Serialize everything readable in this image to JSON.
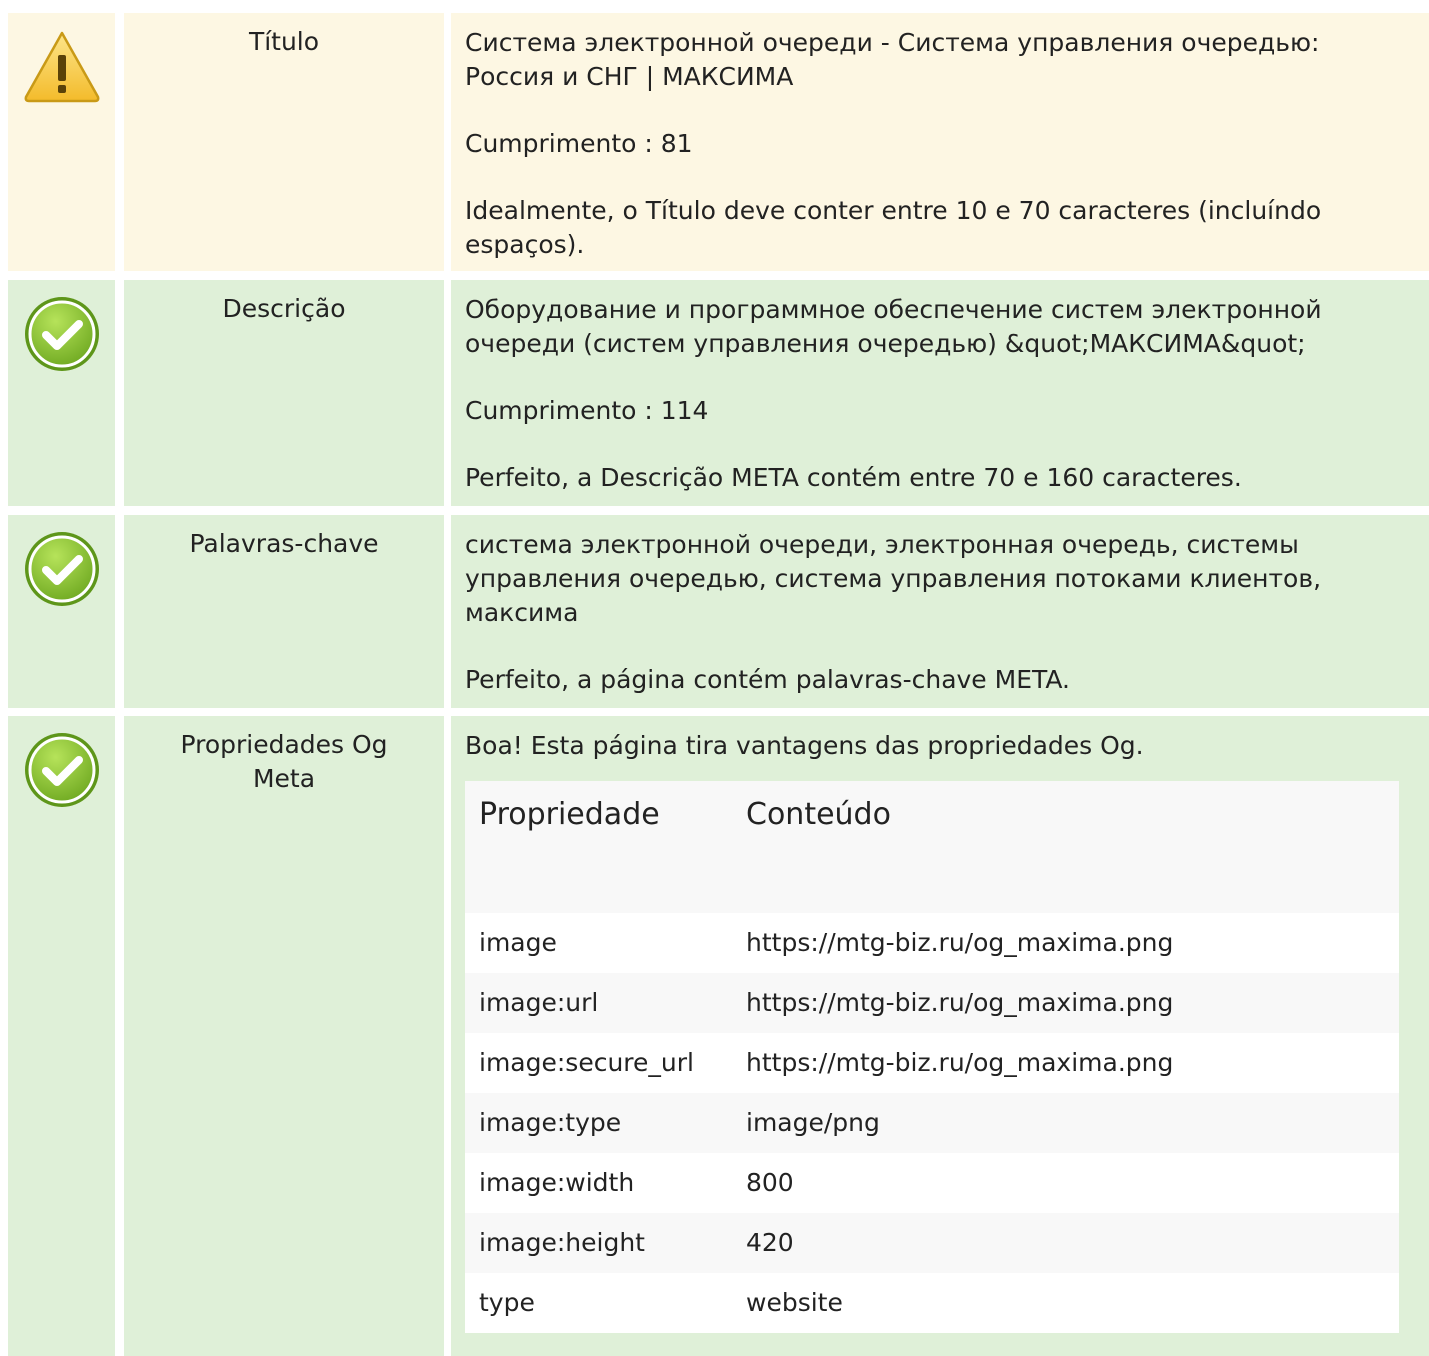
{
  "rows": [
    {
      "status": "warning",
      "label": "Título",
      "lines": [
        "Система электронной очереди - Система управления очередью: Россия и СНГ | МАКСИМА",
        "Cumprimento : 81",
        "Idealmente, o Título deve conter entre 10 e 70 caracteres (incluíndo espaços)."
      ]
    },
    {
      "status": "ok",
      "label": "Descrição",
      "lines": [
        "Оборудование и программное обеспечение систем электронной очереди (систем управления очередью) &quot;МАКСИМА&quot;",
        "Cumprimento : 114",
        "Perfeito, a Descrição META contém entre 70 e 160 caracteres."
      ]
    },
    {
      "status": "ok",
      "label": "Palavras-chave",
      "lines": [
        "система электронной очереди, электронная очередь, системы управления очередью, система управления потоками клиентов, максима",
        "Perfeito, a página contém palavras-chave META."
      ]
    },
    {
      "status": "ok",
      "label": "Propriedades Og Meta",
      "intro": "Boa! Esta página tira vantagens das propriedades Og.",
      "table": {
        "headers": [
          "Propriedade",
          "Conteúdo"
        ],
        "rows": [
          [
            "image",
            "https://mtg-biz.ru/og_maxima.png"
          ],
          [
            "image:url",
            "https://mtg-biz.ru/og_maxima.png"
          ],
          [
            "image:secure_url",
            "https://mtg-biz.ru/og_maxima.png"
          ],
          [
            "image:type",
            "image/png"
          ],
          [
            "image:width",
            "800"
          ],
          [
            "image:height",
            "420"
          ],
          [
            "type",
            "website"
          ]
        ]
      }
    }
  ],
  "colors": {
    "warning_bg": "#fdf7e3",
    "ok_bg": "#dff0d8",
    "warning_icon": "#f5c842",
    "ok_icon": "#7fbf2a"
  },
  "icons": {
    "warning": "warning-triangle-icon",
    "ok": "check-circle-icon"
  }
}
